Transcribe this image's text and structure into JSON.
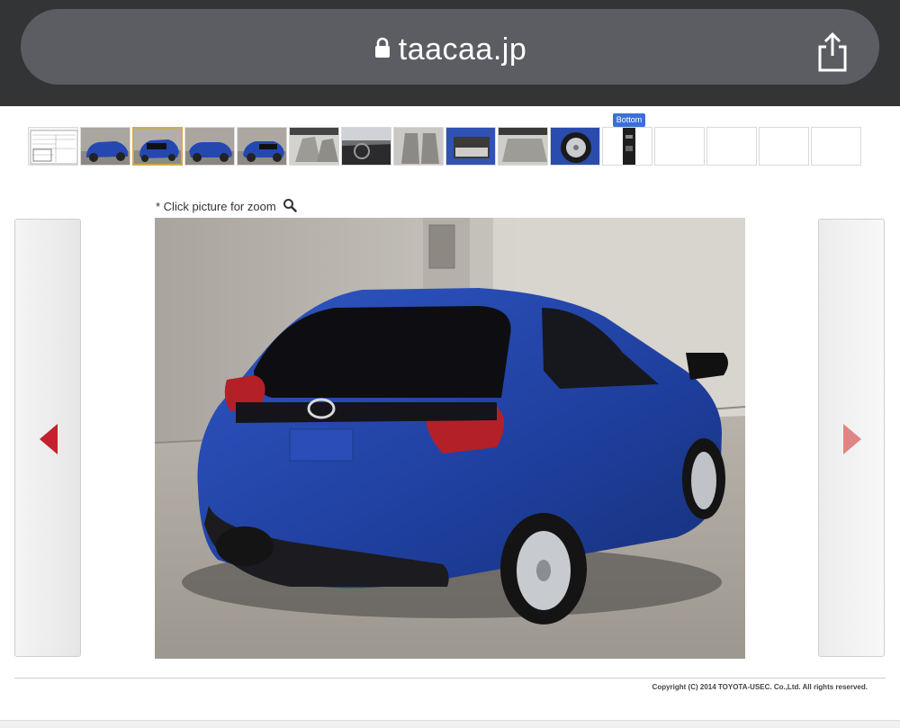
{
  "browser": {
    "url": "taacaa.jp",
    "lock_icon": "lock-icon",
    "share_icon": "share-icon"
  },
  "gallery": {
    "bottom_tab_label": "Bottom",
    "thumbnails": [
      {
        "kind": "inspection-sheet"
      },
      {
        "kind": "front-left"
      },
      {
        "kind": "rear-right",
        "active": true
      },
      {
        "kind": "front-right"
      },
      {
        "kind": "rear-left"
      },
      {
        "kind": "interior-front"
      },
      {
        "kind": "dashboard"
      },
      {
        "kind": "seats"
      },
      {
        "kind": "trunk"
      },
      {
        "kind": "rear-seats"
      },
      {
        "kind": "wheel"
      },
      {
        "kind": "underside"
      },
      {
        "kind": "empty"
      },
      {
        "kind": "empty"
      },
      {
        "kind": "empty"
      },
      {
        "kind": "empty"
      }
    ],
    "zoom_hint": "* Click picture for zoom",
    "zoom_icon": "magnifier-icon",
    "prev_icon": "arrow-left-icon",
    "next_icon": "arrow-right-icon",
    "colors": {
      "prev_arrow": "#c4202d",
      "next_arrow": "#e08585",
      "active_thumb_border": "#d4a94a",
      "car_body": "#2548b0"
    }
  },
  "footer": {
    "copyright": "Copyright (C) 2014 TOYOTA-USEC. Co.,Ltd. All rights reserved."
  }
}
